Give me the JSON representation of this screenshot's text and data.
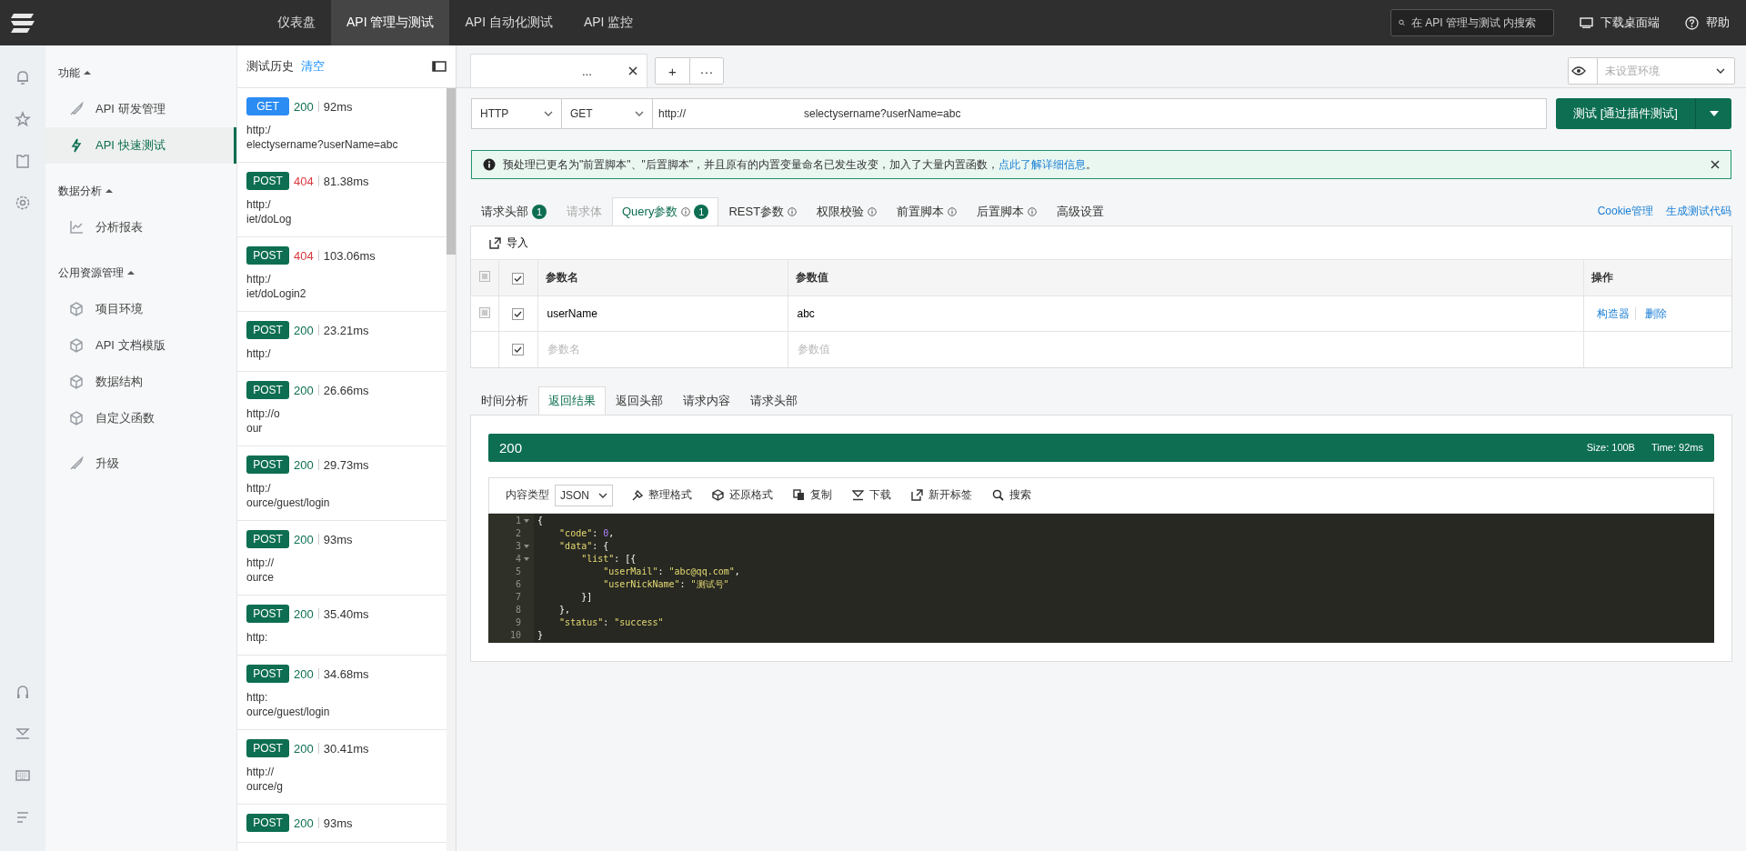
{
  "top_bar": {
    "nav": [
      {
        "label": "仪表盘",
        "selected": false
      },
      {
        "label": "API 管理与测试",
        "selected": true
      },
      {
        "label": "API 自动化测试",
        "selected": false
      },
      {
        "label": "API 监控",
        "selected": false
      }
    ],
    "search": {
      "placeholder": "在 API 管理与测试 内搜索"
    },
    "download": "下载桌面端",
    "help": "帮助"
  },
  "sidebar": {
    "sections": [
      {
        "title": "功能",
        "expanded": true,
        "items": [
          {
            "label": "API 研发管理",
            "selected": false
          },
          {
            "label": "API 快速测试",
            "selected": true
          }
        ]
      },
      {
        "title": "数据分析",
        "expanded": true,
        "items": [
          {
            "label": "分析报表",
            "selected": false
          }
        ]
      },
      {
        "title": "公用资源管理",
        "expanded": true,
        "items": [
          {
            "label": "项目环境",
            "selected": false
          },
          {
            "label": "API 文档模版",
            "selected": false
          },
          {
            "label": "数据结构",
            "selected": false
          },
          {
            "label": "自定义函数",
            "selected": false
          }
        ]
      }
    ],
    "upgrade": {
      "label": "升级",
      "selected": false
    }
  },
  "history": {
    "title": "测试历史",
    "clear": "清空",
    "items": [
      {
        "method": "GET",
        "status": "200",
        "error": false,
        "time": "92ms",
        "url_lines": [
          "http:/",
          "electysername?userName=abc"
        ]
      },
      {
        "method": "POST",
        "status": "404",
        "error": true,
        "time": "81.38ms",
        "url_lines": [
          "http:/",
          "iet/doLog"
        ]
      },
      {
        "method": "POST",
        "status": "404",
        "error": true,
        "time": "103.06ms",
        "url_lines": [
          "http:/",
          "iet/doLogin2"
        ]
      },
      {
        "method": "POST",
        "status": "200",
        "error": false,
        "time": "23.21ms",
        "url_lines": [
          "http:/"
        ]
      },
      {
        "method": "POST",
        "status": "200",
        "error": false,
        "time": "26.66ms",
        "url_lines": [
          "http://o",
          "our"
        ]
      },
      {
        "method": "POST",
        "status": "200",
        "error": false,
        "time": "29.73ms",
        "url_lines": [
          "http:/",
          "ource/guest/login"
        ]
      },
      {
        "method": "POST",
        "status": "200",
        "error": false,
        "time": "93ms",
        "url_lines": [
          "http://",
          "ource"
        ]
      },
      {
        "method": "POST",
        "status": "200",
        "error": false,
        "time": "35.40ms",
        "url_lines": [
          "http:"
        ]
      },
      {
        "method": "POST",
        "status": "200",
        "error": false,
        "time": "34.68ms",
        "url_lines": [
          "http:",
          "ource/guest/login"
        ]
      },
      {
        "method": "POST",
        "status": "200",
        "error": false,
        "time": "30.41ms",
        "url_lines": [
          "http://",
          "ource/g"
        ]
      },
      {
        "method": "POST",
        "status": "200",
        "error": false,
        "time": "93ms"
      }
    ]
  },
  "tabs": {
    "open": [
      {
        "title": "...",
        "selected": true
      }
    ],
    "add_label": "+",
    "more_label": "···",
    "environment": {
      "placeholder": "未设置环境"
    }
  },
  "request": {
    "protocol": "HTTP",
    "method": "GET",
    "url_prefix": "http://",
    "url_suffix": "selectysername?userName=abc",
    "send_button": "测试 [通过插件测试]"
  },
  "notice": {
    "text": "预处理已更名为\"前置脚本\"、\"后置脚本\"，并且原有的内置变量命名已发生改变，加入了大量内置函数，",
    "link": "点此了解详细信息",
    "end": "。"
  },
  "request_tabs": [
    {
      "label": "请求头部",
      "badge": "1",
      "info": false,
      "disabled": false,
      "selected": false
    },
    {
      "label": "请求体",
      "info": false,
      "disabled": true,
      "selected": false
    },
    {
      "label": "Query参数",
      "badge": "1",
      "info": true,
      "disabled": false,
      "selected": true
    },
    {
      "label": "REST参数",
      "info": true,
      "disabled": false,
      "selected": false
    },
    {
      "label": "权限校验",
      "info": true,
      "disabled": false,
      "selected": false
    },
    {
      "label": "前置脚本",
      "info": true,
      "disabled": false,
      "selected": false
    },
    {
      "label": "后置脚本",
      "info": true,
      "disabled": false,
      "selected": false
    },
    {
      "label": "高级设置",
      "info": false,
      "disabled": false,
      "selected": false
    }
  ],
  "request_links": [
    "Cookie管理",
    "生成测试代码"
  ],
  "params": {
    "import": "导入",
    "all_checked": true,
    "columns": [
      "参数名",
      "参数值",
      "操作"
    ],
    "rows": [
      {
        "kind": "param",
        "checked": true,
        "name": "userName",
        "value": "abc",
        "actions": [
          "构造器",
          "删除"
        ]
      },
      {
        "kind": "new",
        "checked": true,
        "name_placeholder": "参数名",
        "value_placeholder": "参数值"
      }
    ]
  },
  "response_tabs": [
    {
      "label": "时间分析",
      "selected": false
    },
    {
      "label": "返回结果",
      "selected": true
    },
    {
      "label": "返回头部",
      "selected": false
    },
    {
      "label": "请求内容",
      "selected": false
    },
    {
      "label": "请求头部",
      "selected": false
    }
  ],
  "response": {
    "status": "200",
    "size": "Size: 100B",
    "time": "Time: 92ms",
    "content_type_label": "内容类型",
    "content_type": "JSON",
    "tools": [
      "整理格式",
      "还原格式",
      "复制",
      "下载",
      "新开标签",
      "搜索"
    ],
    "code": [
      {
        "num": "1",
        "foldable": true,
        "text": "{"
      },
      {
        "num": "2",
        "foldable": false,
        "text": "    \"code\": 0,"
      },
      {
        "num": "3",
        "foldable": true,
        "text": "    \"data\": {"
      },
      {
        "num": "4",
        "foldable": true,
        "text": "        \"list\": [{"
      },
      {
        "num": "5",
        "foldable": false,
        "text": "            \"userMail\": \"abc@qq.com\","
      },
      {
        "num": "6",
        "foldable": false,
        "text": "            \"userNickName\": \"测试号\""
      },
      {
        "num": "7",
        "foldable": false,
        "text": "        }]"
      },
      {
        "num": "8",
        "foldable": false,
        "text": "    },"
      },
      {
        "num": "9",
        "foldable": false,
        "text": "    \"status\": \"success\""
      },
      {
        "num": "10",
        "foldable": false,
        "text": "}"
      }
    ]
  }
}
